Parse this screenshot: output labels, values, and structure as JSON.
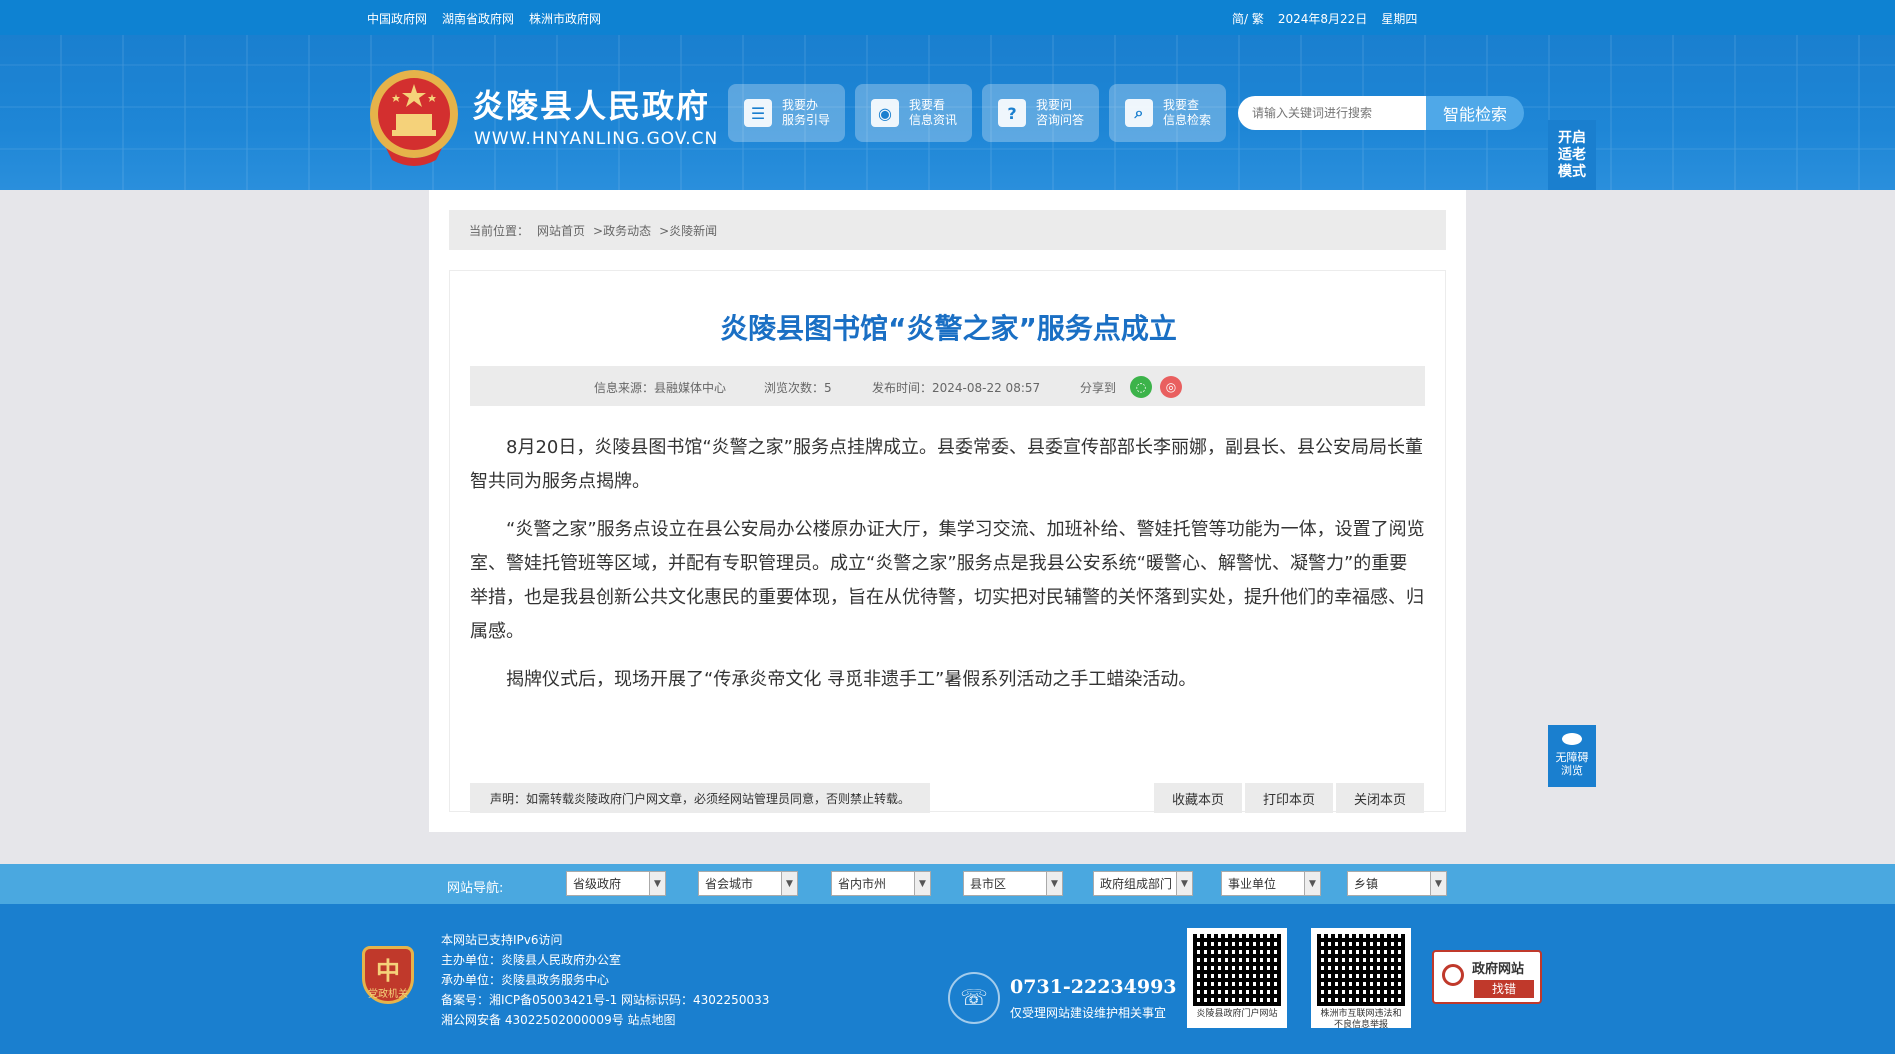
{
  "topbar": {
    "links": [
      "中国政府网",
      "湖南省政府网",
      "株洲市政府网"
    ],
    "lang": "简/ 繁",
    "date": "2024年8月22日",
    "weekday": "星期四"
  },
  "header": {
    "site_name": "炎陵县人民政府",
    "domain": "WWW.HNYANLING.GOV.CN",
    "services": [
      {
        "icon": "document-icon",
        "line1": "我要办",
        "line2": "服务引导"
      },
      {
        "icon": "eye-icon",
        "line1": "我要看",
        "line2": "信息资讯"
      },
      {
        "icon": "question-icon",
        "line1": "我要问",
        "line2": "咨询问答"
      },
      {
        "icon": "search-icon",
        "line1": "我要查",
        "line2": "信息检索"
      }
    ],
    "search_placeholder": "请输入关键词进行搜索",
    "search_button": "智能检索",
    "elder_mode": "开启适老模式"
  },
  "breadcrumb": {
    "label": "当前位置：",
    "items": [
      "网站首页",
      ">政务动态",
      ">炎陵新闻"
    ]
  },
  "article": {
    "title": "炎陵县图书馆“炎警之家”服务点成立",
    "meta": {
      "source": "信息来源：县融媒体中心",
      "views": "浏览次数：5",
      "published": "发布时间：2024-08-22 08:57",
      "share": "分享到"
    },
    "paragraphs": [
      "8月20日，炎陵县图书馆“炎警之家”服务点挂牌成立。县委常委、县委宣传部部长李丽娜，副县长、县公安局局长董智共同为服务点揭牌。",
      "“炎警之家”服务点设立在县公安局办公楼原办证大厅，集学习交流、加班补给、警娃托管等功能为一体，设置了阅览室、警娃托管班等区域，并配有专职管理员。成立“炎警之家”服务点是我县公安系统“暖警心、解警忧、凝警力”的重要举措，也是我县创新公共文化惠民的重要体现，旨在从优待警，切实把对民辅警的关怀落到实处，提升他们的幸福感、归属感。",
      "揭牌仪式后，现场开展了“传承炎帝文化 寻觅非遗手工”暑假系列活动之手工蜡染活动。"
    ],
    "disclaimer": "声明：如需转载炎陵政府门户网文章，必须经网站管理员同意，否则禁止转载。",
    "actions": [
      "收藏本页",
      "打印本页",
      "关闭本页"
    ]
  },
  "a11y": {
    "line1": "无障碍",
    "line2": "浏览"
  },
  "site_nav": {
    "label": "网站导航:",
    "selects": [
      "省级政府",
      "省会城市",
      "省内市州",
      "县市区",
      "政府组成部门",
      "事业单位",
      "乡镇"
    ]
  },
  "footer": {
    "party_badge": "党政机关",
    "info": [
      "本网站已支持IPv6访问",
      "主办单位：炎陵县人民政府办公室",
      "承办单位：炎陵县政务服务中心",
      "备案号：湘ICP备05003421号-1 网站标识码：4302250033",
      "湘公网安备 43022502000009号 站点地图"
    ],
    "phone": "0731-22234993",
    "phone_note": "仅受理网站建设维护相关事宜",
    "qr1_caption": "炎陵县政府门户网站",
    "qr2_caption": "株洲市互联网违法和不良信息举报",
    "gov_error_title": "政府网站",
    "gov_error_btn": "找错"
  },
  "colors": {
    "primary": "#1a7fcf",
    "title": "#1a6fc4",
    "navbar": "#4aa8e0"
  }
}
